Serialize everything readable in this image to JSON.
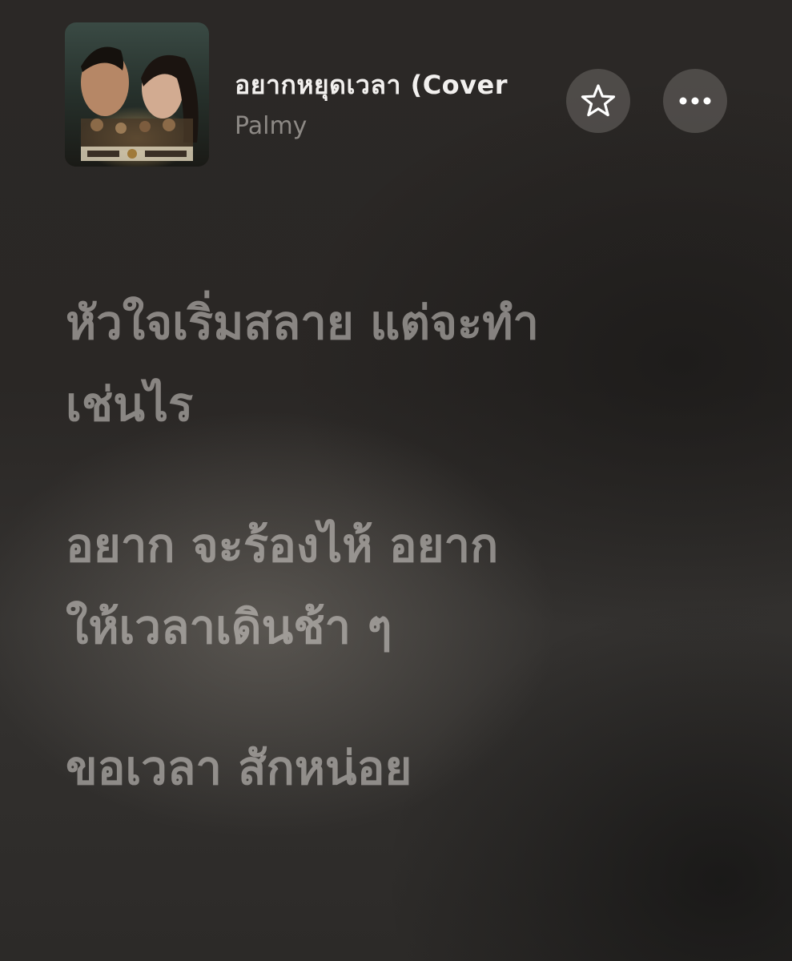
{
  "now_playing": {
    "title": "อยากหยุดเวลา (Cover",
    "artist": "Palmy",
    "artwork_icon": "album-artwork"
  },
  "actions": {
    "favorite_icon": "star-icon",
    "more_icon": "ellipsis-icon"
  },
  "lyrics": {
    "blocks": [
      {
        "lines": [
          "หัวใจเริ่มสลาย แต่จะทำ",
          "เช่นไร"
        ]
      },
      {
        "lines": [
          "อยาก จะร้องไห้ อยาก",
          "ให้เวลาเดินช้า ๆ"
        ]
      },
      {
        "lines": [
          "ขอเวลา สักหน่อย"
        ]
      }
    ]
  },
  "colors": {
    "background": "#2a2725",
    "title_text": "#f2f0ee",
    "artist_text": "#8d8985",
    "lyric_text": "#e8e4e0",
    "button_bg": "#64615e"
  }
}
